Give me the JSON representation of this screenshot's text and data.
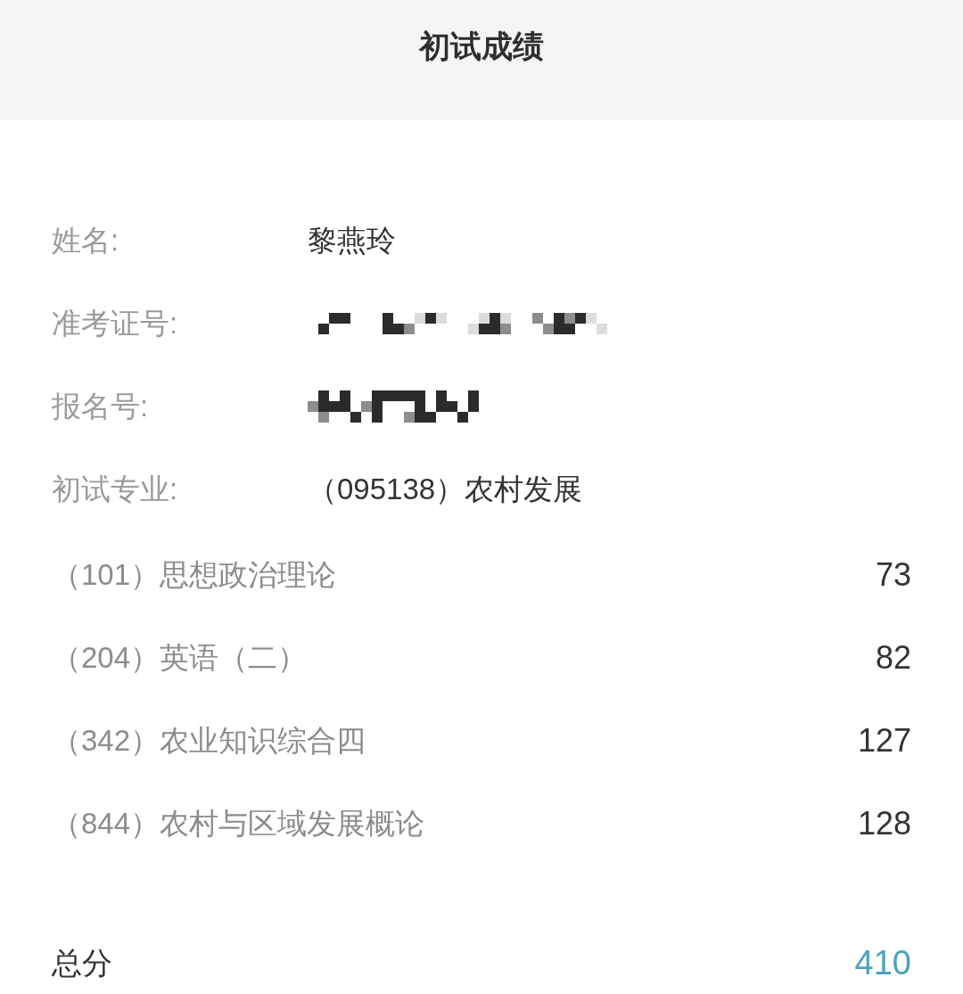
{
  "header": {
    "title": "初试成绩"
  },
  "info": [
    {
      "label": "姓名:",
      "kind": "text",
      "value": "黎燕玲"
    },
    {
      "label": "准考证号:",
      "kind": "masked"
    },
    {
      "label": "报名号:",
      "kind": "masked"
    },
    {
      "label": "初试专业:",
      "kind": "text",
      "value": "（095138）农村发展"
    }
  ],
  "subjects": [
    {
      "name": "（101）思想政治理论",
      "score": "73"
    },
    {
      "name": "（204）英语（二）",
      "score": "82"
    },
    {
      "name": "（342）农业知识综合四",
      "score": "127"
    },
    {
      "name": "（844）农村与区域发展概论",
      "score": "128"
    }
  ],
  "total": {
    "label": "总分",
    "score": "410"
  }
}
